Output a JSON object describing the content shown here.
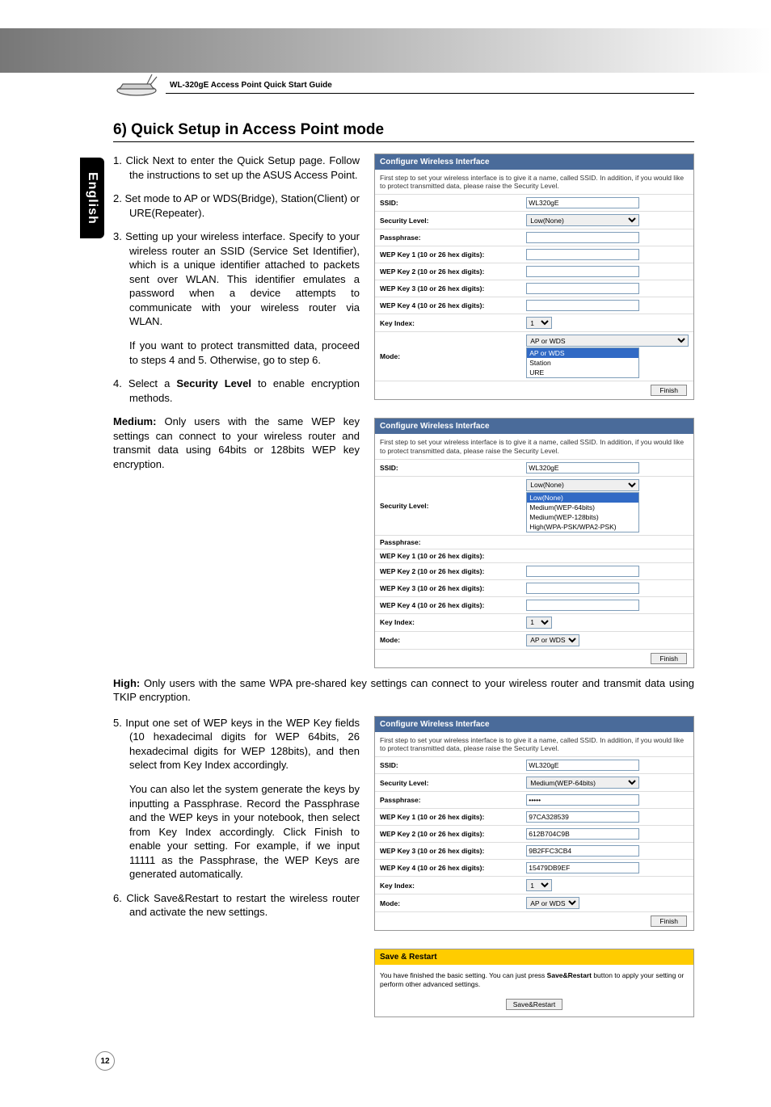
{
  "header": {
    "guide_title": "WL-320gE Access Point Quick Start Guide"
  },
  "lang_tab": "English",
  "section_heading": "6) Quick Setup in Access Point mode",
  "steps": {
    "s1": "1. Click Next to enter the Quick Setup page. Follow the instructions to set up the ASUS Access Point.",
    "s2": "2. Set mode to AP or WDS(Bridge), Station(Client) or URE(Repeater).",
    "s3": "3. Setting up your wireless interface. Specify to your wireless router an SSID (Service Set Identifier), which is a unique identifier attached to packets sent over WLAN. This identifier emulates a password when a device attempts to communicate with your wireless router via WLAN.",
    "s3_sub": "If you want to protect transmitted data, proceed to steps 4 and 5. Otherwise, go to step 6.",
    "s4_prefix": "4. Select a ",
    "s4_bold": "Security Level",
    "s4_suffix": " to enable encryption methods.",
    "medium_bold": "Medium:",
    "medium_text": " Only users with the same WEP key settings can connect to your wireless router and transmit data using 64bits or 128bits WEP key encryption.",
    "high_bold": "High:",
    "high_text": " Only users with the same WPA pre-shared key settings can connect to your wireless router and transmit data using TKIP encryption.",
    "s5": "5. Input one set of WEP keys in the WEP Key fields (10 hexadecimal digits for WEP 64bits, 26 hexadecimal digits for WEP 128bits), and then select from Key Index accordingly.",
    "s5_sub": "You can also let the system generate the keys by inputting a Passphrase. Record the Passphrase and the WEP keys in your notebook, then select from Key Index accordingly. Click Finish to enable your setting. For example, if we input 11111 as the Passphrase, the WEP Keys are generated automatically.",
    "s6": "6. Click Save&Restart to restart the wireless router and activate the new settings."
  },
  "labels": {
    "panel_title": "Configure Wireless Interface",
    "panel_desc": "First step to set your wireless interface is to give it a name, called SSID. In addition, if you would like to protect transmitted data, please raise the Security Level.",
    "ssid": "SSID:",
    "security_level": "Security Level:",
    "passphrase": "Passphrase:",
    "wep1": "WEP Key 1 (10 or 26 hex digits):",
    "wep2": "WEP Key 2 (10 or 26 hex digits):",
    "wep3": "WEP Key 3 (10 or 26 hex digits):",
    "wep4": "WEP Key 4 (10 or 26 hex digits):",
    "key_index": "Key Index:",
    "mode": "Mode:",
    "finish": "Finish"
  },
  "panel1": {
    "ssid": "WL320gE",
    "sec_level": "Low(None)",
    "key_index": "1",
    "mode_selected": "AP or WDS",
    "mode_opts": {
      "a": "AP or WDS",
      "b": "Station",
      "c": "URE"
    }
  },
  "panel2": {
    "ssid": "WL320gE",
    "sec_sel": "Low(None)",
    "sec_opts": {
      "a": "Low(None)",
      "b": "Medium(WEP-64bits)",
      "c": "Medium(WEP-128bits)",
      "d": "High(WPA-PSK/WPA2-PSK)"
    },
    "key_index": "1",
    "mode": "AP or WDS"
  },
  "panel3": {
    "ssid": "WL320gE",
    "sec_level": "Medium(WEP-64bits)",
    "pass": "•••••",
    "w1": "97CA328539",
    "w2": "612B704C9B",
    "w3": "9B2FFC3CB4",
    "w4": "15479DB9EF",
    "key_index": "1",
    "mode": "AP or WDS"
  },
  "save": {
    "title": "Save & Restart",
    "body_a": "You have finished the basic setting. You can just press ",
    "body_bold": "Save&Restart",
    "body_b": " button to apply your setting or perform other advanced settings.",
    "btn": "Save&Restart"
  },
  "page_number": "12"
}
